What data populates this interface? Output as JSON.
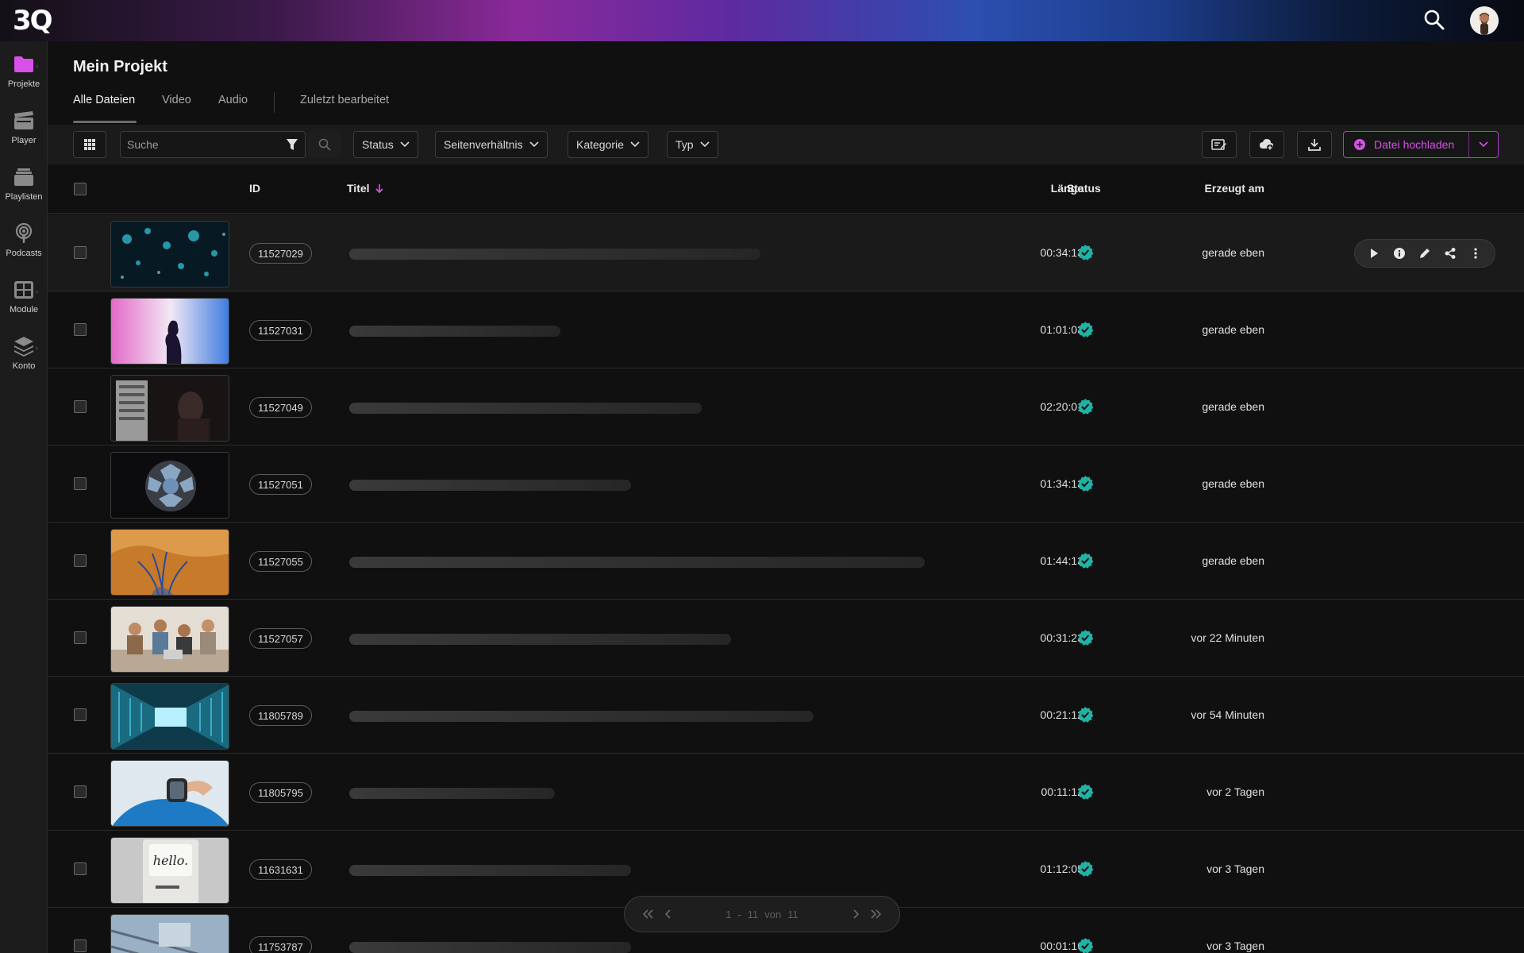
{
  "app": {
    "logo": "3Q",
    "accent_color": "#d850e8",
    "status_color": "#1fb3a5"
  },
  "sidebar": {
    "items": [
      {
        "label": "Projekte",
        "icon": "folder-icon"
      },
      {
        "label": "Player",
        "icon": "clapperboard-icon"
      },
      {
        "label": "Playlisten",
        "icon": "stack-icon"
      },
      {
        "label": "Podcasts",
        "icon": "podcast-icon"
      },
      {
        "label": "Module",
        "icon": "grid-icon"
      },
      {
        "label": "Konto",
        "icon": "layers-icon"
      }
    ]
  },
  "page": {
    "title": "Mein Projekt",
    "tabs": [
      "Alle Dateien",
      "Video",
      "Audio",
      "Zuletzt bearbeitet"
    ]
  },
  "toolbar": {
    "search_placeholder": "Suche",
    "filters": [
      "Status",
      "Seitenverhältnis",
      "Kategorie",
      "Typ"
    ],
    "upload_label": "Datei hochladen"
  },
  "table": {
    "columns": {
      "id": "ID",
      "title": "Titel",
      "duration": "Länge",
      "status": "Status",
      "created": "Erzeugt am"
    },
    "rows": [
      {
        "id": "11527029",
        "duration": "00:34:13",
        "created": "gerade eben",
        "title_fill": 0.7,
        "thumb": "light-fibers"
      },
      {
        "id": "11527031",
        "duration": "01:01:03",
        "created": "gerade eben",
        "title_fill": 0.36,
        "thumb": "silhouette"
      },
      {
        "id": "11527049",
        "duration": "02:20:01",
        "created": "gerade eben",
        "title_fill": 0.6,
        "thumb": "server-rack"
      },
      {
        "id": "11527051",
        "duration": "01:34:13",
        "created": "gerade eben",
        "title_fill": 0.48,
        "thumb": "space-window"
      },
      {
        "id": "11527055",
        "duration": "01:44:13",
        "created": "gerade eben",
        "title_fill": 0.98,
        "thumb": "aerial-terrain"
      },
      {
        "id": "11527057",
        "duration": "00:31:23",
        "created": "vor 22 Minuten",
        "title_fill": 0.65,
        "thumb": "team-meeting"
      },
      {
        "id": "11805789",
        "duration": "00:21:12",
        "created": "vor 54 Minuten",
        "title_fill": 0.79,
        "thumb": "datacenter"
      },
      {
        "id": "11805795",
        "duration": "00:11:12",
        "created": "vor 2 Tagen",
        "title_fill": 0.35,
        "thumb": "smartwatch"
      },
      {
        "id": "11631631",
        "duration": "01:12:05",
        "created": "vor 3 Tagen",
        "title_fill": 0.48,
        "thumb": "hello-computer"
      },
      {
        "id": "11753787",
        "duration": "00:01:16",
        "created": "vor 3 Tagen",
        "title_fill": 0.48,
        "thumb": "machine"
      }
    ]
  },
  "pagination": {
    "from": "1",
    "sep": "-",
    "to": "11",
    "of_label": "von",
    "total": "11"
  }
}
